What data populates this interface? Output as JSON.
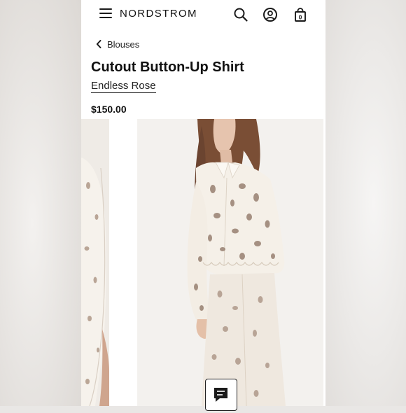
{
  "header": {
    "logo": "NORDSTROM",
    "icons": [
      "menu-icon",
      "search-icon",
      "account-icon",
      "bag-icon"
    ],
    "bag_count": "0"
  },
  "breadcrumb": {
    "label": "Blouses",
    "icon": "chevron-left-icon"
  },
  "product": {
    "title": "Cutout Button-Up Shirt",
    "brand": "Endless Rose",
    "price": "$150.00"
  },
  "gallery": {
    "images": [
      "previous-product-photo",
      "main-product-photo"
    ]
  },
  "chat": {
    "icon": "chat-icon"
  },
  "colors": {
    "text": "#111111",
    "background": "#ffffff",
    "garment": "#f2ede6",
    "hair": "#7a4e35"
  }
}
